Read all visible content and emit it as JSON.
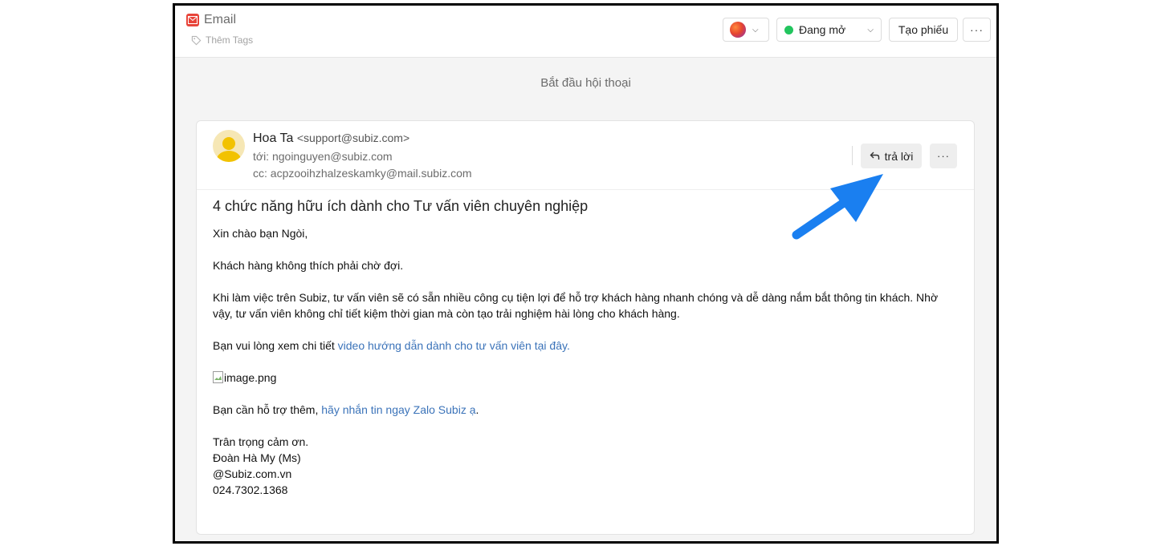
{
  "header": {
    "app_title": "Email",
    "tags_label": "Thêm Tags",
    "status_label": "Đang mở",
    "create_ticket_label": "Tạo phiếu",
    "more_label": "···",
    "status_color": "#22c55e"
  },
  "conversation": {
    "start_label": "Bắt đầu hội thoại"
  },
  "email": {
    "sender_name": "Hoa Ta",
    "sender_email": "<support@subiz.com>",
    "to_line": "tới: ngoinguyen@subiz.com",
    "cc_line": "cc: acpzooihzhalzeskamky@mail.subiz.com",
    "reply_label": "trả lời",
    "more_label": "···",
    "subject": "4 chức năng hữu ích dành cho Tư vấn viên chuyên nghiệp",
    "greeting": "Xin chào bạn Ngòi,",
    "para1": "Khách hàng không thích phải chờ đợi.",
    "para2": "Khi làm việc trên Subiz, tư vấn viên sẽ có sẵn nhiều công cụ tiện lợi để hỗ trợ khách hàng nhanh chóng và dễ dàng nắm bắt thông tin khách. Nhờ vậy, tư vấn viên không chỉ tiết kiệm thời gian mà còn tạo trải nghiệm hài lòng cho khách hàng.",
    "para3_prefix": "Bạn vui lòng xem chi tiết ",
    "para3_link": "video hướng dẫn dành cho tư vấn viên tại đây.",
    "image_alt": "image.png",
    "para4_prefix": "Bạn cần hỗ trợ thêm, ",
    "para4_link": "hãy nhắn tin ngay Zalo Subiz ạ",
    "para4_suffix": ".",
    "sign_off": "Trân trọng cảm ơn.",
    "signature_name": "Đoàn Hà My (Ms)",
    "signature_site": "@Subiz.com.vn",
    "signature_phone": "024.7302.1368",
    "link_color": "#3b73b9"
  },
  "annotation": {
    "arrow_icon": "blue-pointer-arrow-icon",
    "arrow_color": "#1a7ff0"
  }
}
